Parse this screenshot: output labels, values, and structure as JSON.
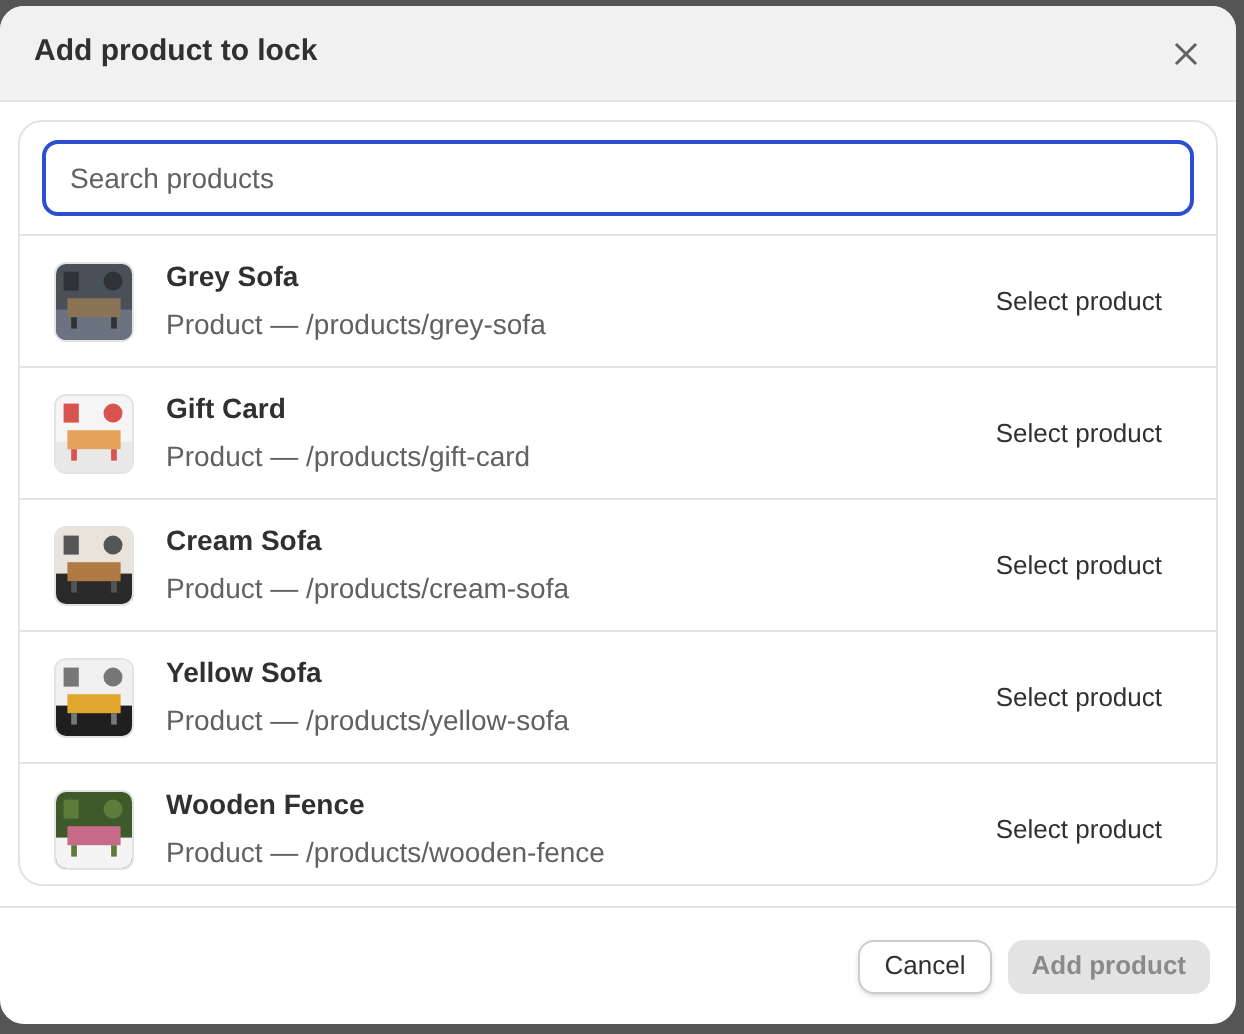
{
  "dialog": {
    "title": "Add product to lock"
  },
  "search": {
    "placeholder": "Search products"
  },
  "products": [
    {
      "name": "Grey Sofa",
      "path": "Product — /products/grey-sofa",
      "action": "Select product"
    },
    {
      "name": "Gift Card",
      "path": "Product — /products/gift-card",
      "action": "Select product"
    },
    {
      "name": "Cream Sofa",
      "path": "Product — /products/cream-sofa",
      "action": "Select product"
    },
    {
      "name": "Yellow Sofa",
      "path": "Product — /products/yellow-sofa",
      "action": "Select product"
    },
    {
      "name": "Wooden Fence",
      "path": "Product — /products/wooden-fence",
      "action": "Select product"
    }
  ],
  "footer": {
    "buttons": [
      {
        "label": "Cancel",
        "kind": "secondary",
        "disabled": false
      },
      {
        "label": "Add product",
        "kind": "primary",
        "disabled": true
      }
    ]
  }
}
